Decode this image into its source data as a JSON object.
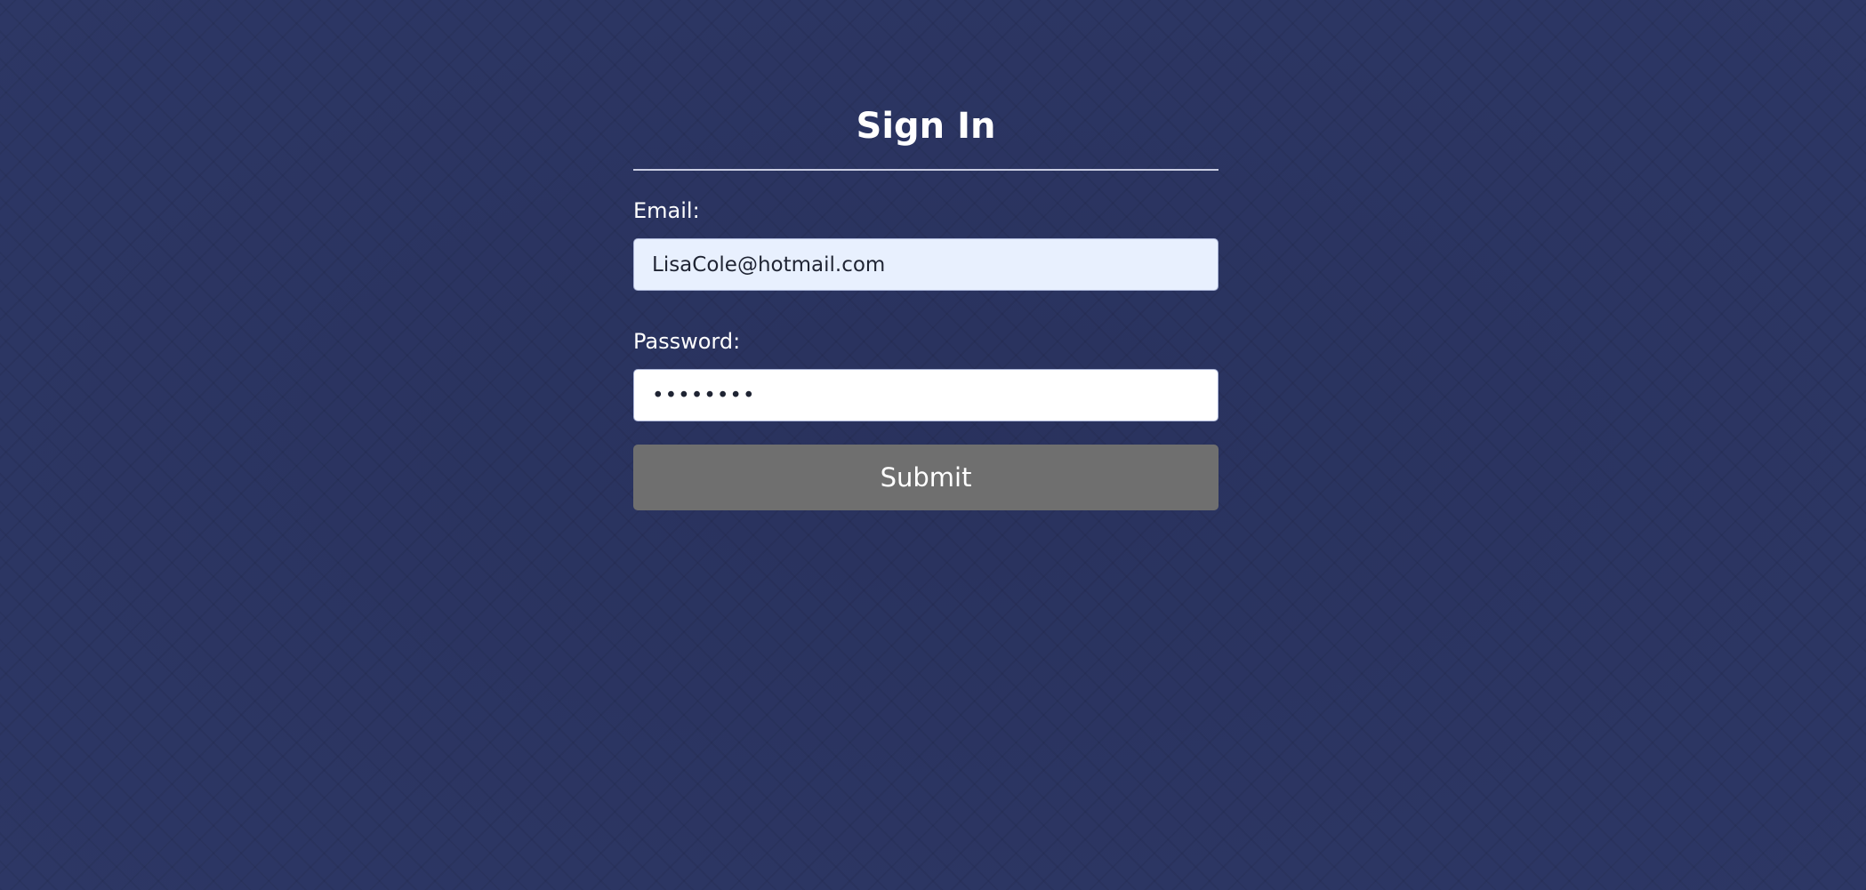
{
  "signin": {
    "title": "Sign In",
    "email_label": "Email:",
    "email_value": "LisaCole@hotmail.com",
    "password_label": "Password:",
    "password_value": "password",
    "submit_label": "Submit"
  },
  "colors": {
    "background": "#2d3765",
    "email_field_bg": "#e8f0fe",
    "submit_button_bg": "#6f6f6f"
  }
}
